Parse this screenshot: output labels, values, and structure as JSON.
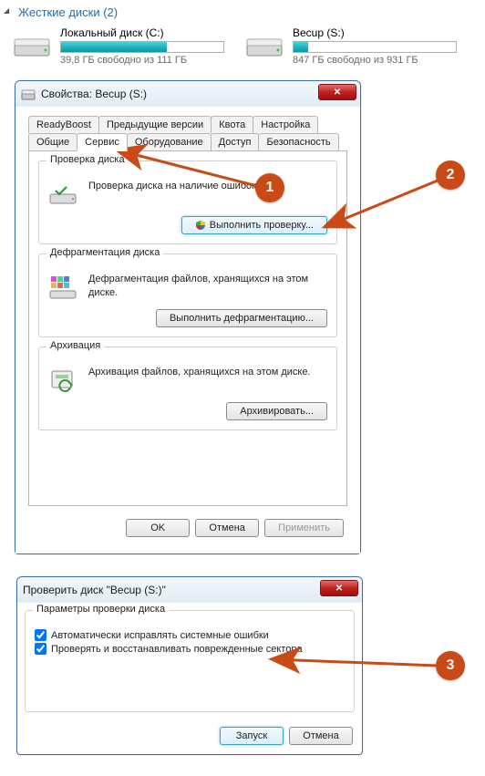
{
  "header": {
    "title": "Жесткие диски (2)"
  },
  "drives": [
    {
      "label": "Локальный диск (C:)",
      "subtext": "39,8 ГБ свободно из 111 ГБ",
      "fill_pct": 65
    },
    {
      "label": "Becup (S:)",
      "subtext": "847 ГБ свободно из 931 ГБ",
      "fill_pct": 9
    }
  ],
  "properties_dialog": {
    "title": "Свойства: Becup (S:)",
    "tabs_row1": [
      "ReadyBoost",
      "Предыдущие версии",
      "Квота",
      "Настройка"
    ],
    "tabs_row2": [
      "Общие",
      "Сервис",
      "Оборудование",
      "Доступ",
      "Безопасность"
    ],
    "active_tab": "Сервис",
    "groups": {
      "check": {
        "title": "Проверка диска",
        "text": "Проверка диска на наличие ошибок.",
        "button": "Выполнить проверку..."
      },
      "defrag": {
        "title": "Дефрагментация диска",
        "text": "Дефрагментация файлов, хранящихся на этом диске.",
        "button": "Выполнить дефрагментацию..."
      },
      "backup": {
        "title": "Архивация",
        "text": "Архивация файлов, хранящихся на этом диске.",
        "button": "Архивировать..."
      }
    },
    "buttons": {
      "ok": "OK",
      "cancel": "Отмена",
      "apply": "Применить"
    }
  },
  "check_dialog": {
    "title": "Проверить диск \"Becup (S:)\"",
    "group_title": "Параметры проверки диска",
    "option1": "Автоматически исправлять системные ошибки",
    "option2": "Проверять и восстанавливать поврежденные сектора",
    "buttons": {
      "start": "Запуск",
      "cancel": "Отмена"
    }
  },
  "callouts": {
    "c1": "1",
    "c2": "2",
    "c3": "3"
  }
}
